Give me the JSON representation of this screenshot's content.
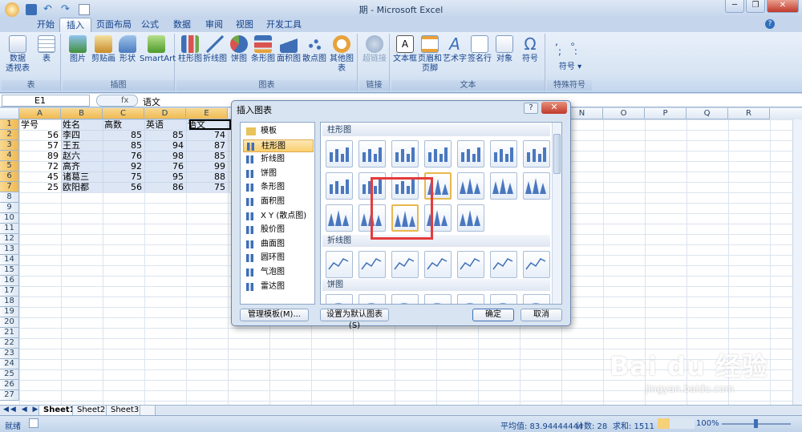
{
  "window": {
    "title": "期 - Microsoft Excel",
    "minimize": "─",
    "restore": "❐",
    "close": "✕"
  },
  "tabs": [
    "开始",
    "插入",
    "页面布局",
    "公式",
    "数据",
    "审阅",
    "视图",
    "开发工具"
  ],
  "active_tab": "插入",
  "ribbon": {
    "groups": [
      {
        "label": "表",
        "buttons": [
          "数据\n透视表",
          "表"
        ]
      },
      {
        "label": "插图",
        "buttons": [
          "图片",
          "剪贴画",
          "形状",
          "SmartArt"
        ]
      },
      {
        "label": "图表",
        "buttons": [
          "柱形图",
          "折线图",
          "饼图",
          "条形图",
          "面积图",
          "散点图",
          "其他图表"
        ]
      },
      {
        "label": "链接",
        "buttons": [
          "超链接"
        ]
      },
      {
        "label": "文本",
        "buttons": [
          "文本框",
          "页眉和\n页脚",
          "艺术字",
          "签名行",
          "对象",
          "符号"
        ]
      },
      {
        "label": "特殊符号",
        "buttons": [
          "符号"
        ]
      }
    ]
  },
  "formula_bar": {
    "name_box": "E1",
    "fx": "fx",
    "value": "语文"
  },
  "columns": [
    "A",
    "B",
    "C",
    "D",
    "E",
    "F",
    "G",
    "H",
    "I",
    "J",
    "K",
    "L",
    "M",
    "N",
    "O",
    "P",
    "Q",
    "R"
  ],
  "rows": [
    "1",
    "2",
    "3",
    "4",
    "5",
    "6",
    "7",
    "8",
    "9",
    "10",
    "11",
    "12",
    "13",
    "14",
    "15",
    "16",
    "17",
    "18",
    "19",
    "20",
    "21",
    "22",
    "23",
    "24",
    "25",
    "26",
    "27"
  ],
  "table": [
    [
      "学号",
      "姓名",
      "高数",
      "英语",
      "语文"
    ],
    [
      "56",
      "李四",
      "85",
      "85",
      "74"
    ],
    [
      "57",
      "王五",
      "85",
      "94",
      "87"
    ],
    [
      "89",
      "赵六",
      "76",
      "98",
      "85"
    ],
    [
      "72",
      "高齐",
      "92",
      "76",
      "99"
    ],
    [
      "45",
      "诸葛三",
      "75",
      "95",
      "88"
    ],
    [
      "25",
      "欧阳都",
      "56",
      "86",
      "75"
    ]
  ],
  "sheet_tabs": [
    "Sheet1",
    "Sheet2",
    "Sheet3"
  ],
  "status": {
    "ready": "就绪",
    "average": "平均值: 83.94444444",
    "count": "计数: 28",
    "sum": "求和: 1511",
    "zoom": "100%"
  },
  "dialog": {
    "title": "插入图表",
    "help": "?",
    "close": "✕",
    "categories": [
      "模板",
      "柱形图",
      "折线图",
      "饼图",
      "条形图",
      "面积图",
      "X Y (散点图)",
      "股价图",
      "曲面图",
      "圆环图",
      "气泡图",
      "雷达图"
    ],
    "selected_category": "柱形图",
    "sections": [
      "柱形图",
      "折线图",
      "饼图"
    ],
    "buttons": {
      "manage": "管理模板(M)...",
      "set_default": "设置为默认图表(S)",
      "ok": "确定",
      "cancel": "取消"
    }
  },
  "watermark": {
    "brand": "Bai du 经验",
    "url": "jingyan.baidu.com"
  },
  "colors": {
    "accent": "#e53b3b",
    "selection": "#f0b952"
  }
}
